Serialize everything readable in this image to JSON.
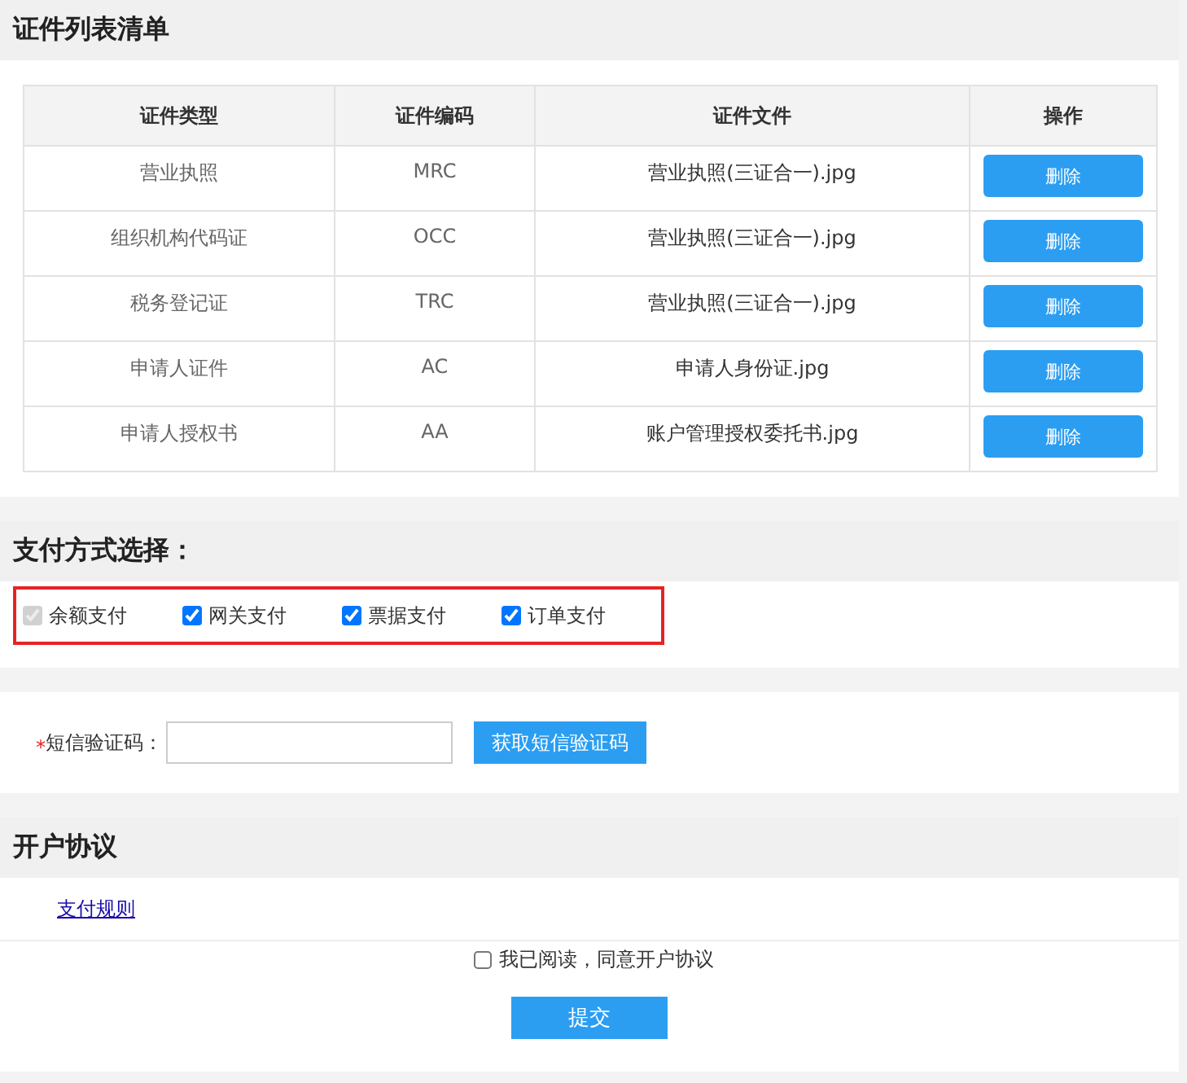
{
  "certificates": {
    "title": "证件列表清单",
    "columns": [
      "证件类型",
      "证件编码",
      "证件文件",
      "操作"
    ],
    "rows": [
      {
        "type": "营业执照",
        "code": "MRC",
        "file": "营业执照(三证合一).jpg",
        "action": "删除"
      },
      {
        "type": "组织机构代码证",
        "code": "OCC",
        "file": "营业执照(三证合一).jpg",
        "action": "删除"
      },
      {
        "type": "税务登记证",
        "code": "TRC",
        "file": "营业执照(三证合一).jpg",
        "action": "删除"
      },
      {
        "type": "申请人证件",
        "code": "AC",
        "file": "申请人身份证.jpg",
        "action": "删除"
      },
      {
        "type": "申请人授权书",
        "code": "AA",
        "file": "账户管理授权委托书.jpg",
        "action": "删除"
      }
    ]
  },
  "payment": {
    "title": "支付方式选择：",
    "options": [
      {
        "label": "余额支付",
        "checked": true,
        "disabled": true
      },
      {
        "label": "网关支付",
        "checked": true,
        "disabled": false
      },
      {
        "label": "票据支付",
        "checked": true,
        "disabled": false
      },
      {
        "label": "订单支付",
        "checked": true,
        "disabled": false
      }
    ]
  },
  "sms": {
    "required_mark": "*",
    "label": "短信验证码：",
    "button": "获取短信验证码"
  },
  "agreement": {
    "title": "开户协议",
    "link": "支付规则",
    "consent": {
      "label": "我已阅读，同意开户协议",
      "checked": false
    },
    "submit": "提交"
  }
}
